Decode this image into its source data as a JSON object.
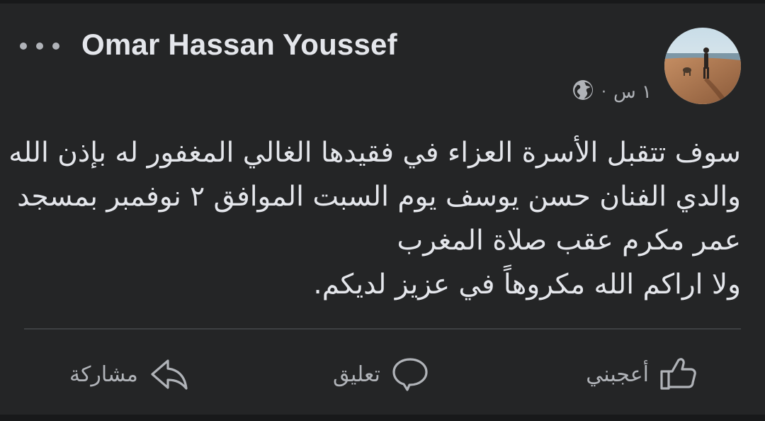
{
  "post": {
    "author": "Omar Hassan Youssef",
    "time": "١ س",
    "separator": "·",
    "lines": [
      "سوف تتقبل الأسرة العزاء في فقيدها الغالي المغفور له بإذن الله",
      "والدي الفنان حسن يوسف يوم السبت الموافق ٢ نوفمبر بمسجد",
      "عمر مكرم عقب صلاة المغرب",
      "ولا اراكم الله مكروهاً في عزيز لديكم."
    ]
  },
  "icons": {
    "more": "more-horizontal-icon",
    "audience": "globe-icon",
    "like": "thumbs-up-icon",
    "comment": "comment-bubble-icon",
    "share": "share-arrow-icon"
  },
  "actions": {
    "like_label": "أعجبني",
    "comment_label": "تعليق",
    "share_label": "مشاركة"
  },
  "colors": {
    "background": "#242526",
    "text_primary": "#e4e6eb",
    "text_secondary": "#b0b3b8",
    "divider": "#3e4042"
  }
}
